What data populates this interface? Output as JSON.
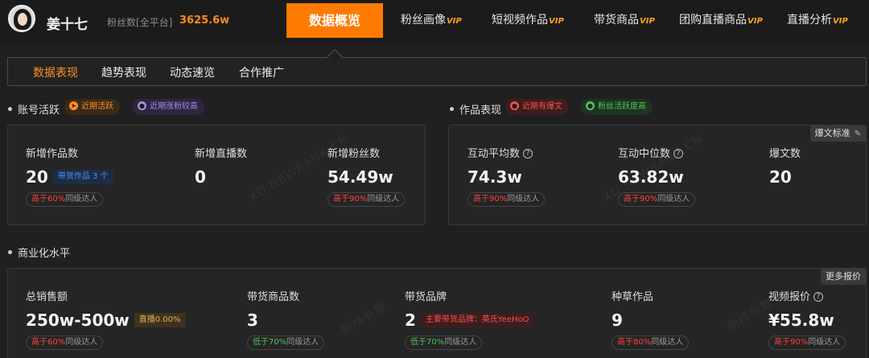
{
  "user": {
    "name": "姜十七",
    "fans_label": "粉丝数[全平台]",
    "fans_value": "3625.6w"
  },
  "nav": {
    "active": "数据概览",
    "tabs": [
      {
        "label": "粉丝画像",
        "vip": "VIP"
      },
      {
        "label": "短视频作品",
        "vip": "VIP"
      },
      {
        "label": "带货商品",
        "vip": "VIP"
      },
      {
        "label": "团购直播商品",
        "vip": "VIP"
      },
      {
        "label": "直播分析",
        "vip": "VIP"
      }
    ]
  },
  "subtabs": [
    "数据表现",
    "趋势表现",
    "动态速览",
    "合作推广"
  ],
  "account": {
    "title": "账号活跃",
    "tags": [
      "近期活跃",
      "近期涨粉较高"
    ],
    "metrics": [
      {
        "label": "新增作品数",
        "value": "20",
        "inline": "带货作品 3 个",
        "cmp_hi": "高于60%",
        "cmp_rest": "同级达人"
      },
      {
        "label": "新增直播数",
        "value": "0"
      },
      {
        "label": "新增粉丝数",
        "value": "54.49w",
        "cmp_hi": "高于90%",
        "cmp_rest": "同级达人"
      }
    ]
  },
  "works": {
    "title": "作品表现",
    "tags": [
      "近期有爆文",
      "粉丝活跃度高"
    ],
    "corner": "爆文标准",
    "metrics": [
      {
        "label": "互动平均数",
        "value": "74.3w",
        "cmp_hi": "高于90%",
        "cmp_rest": "同级达人"
      },
      {
        "label": "互动中位数",
        "value": "63.82w",
        "cmp_hi": "高于90%",
        "cmp_rest": "同级达人"
      },
      {
        "label": "爆文数",
        "value": "20"
      }
    ]
  },
  "commerce": {
    "title": "商业化水平",
    "corner": "更多报价",
    "metrics": [
      {
        "label": "总销售额",
        "value": "250w-500w",
        "inline": "直播0.00%",
        "cmp_hi": "高于60%",
        "cmp_rest": "同级达人"
      },
      {
        "label": "带货商品数",
        "value": "3",
        "cmp_lo": "低于70%",
        "cmp_rest": "同级达人"
      },
      {
        "label": "带货品牌",
        "value": "2",
        "inline": "主要带货品牌：英氏YeeHoO",
        "cmp_lo": "低于70%",
        "cmp_rest": "同级达人"
      },
      {
        "label": "种草作品",
        "value": "9",
        "cmp_hi": "高于80%",
        "cmp_rest": "同级达人"
      },
      {
        "label": "视频报价",
        "value": "¥55.8w",
        "cmp_hi": "高于90%",
        "cmp_rest": "同级达人"
      }
    ]
  },
  "watermark": "XD.NEWRANK.CN",
  "watermark_cn": "新榜有数"
}
